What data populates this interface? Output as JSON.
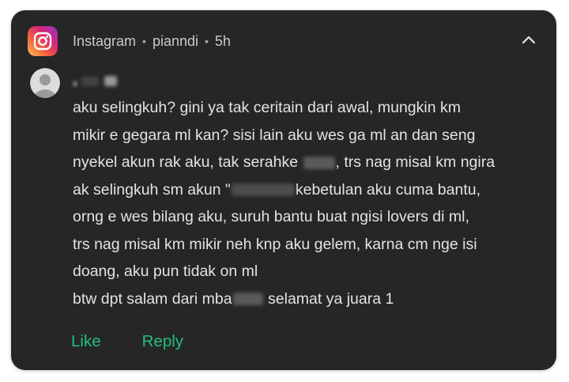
{
  "notification": {
    "app": "Instagram",
    "account": "pianndi",
    "time": "5h",
    "separator": "•",
    "message_lines": [
      "aku selingkuh? gini ya tak ceritain dari awal, mungkin km",
      "mikir e gegara ml kan? sisi lain aku wes ga ml an dan seng",
      [
        "nyekel akun rak aku, tak serahke ",
        ", trs nag misal km ngira"
      ],
      [
        "ak selingkuh sm akun \"",
        "kebetulan aku cuma bantu,"
      ],
      "orng e wes bilang aku, suruh bantu buat ngisi lovers di ml,",
      "trs nag misal km mikir neh knp aku gelem, karna cm nge isi",
      "doang, aku pun tidak on ml",
      [
        "btw dpt salam dari mba",
        " selamat ya juara 1"
      ]
    ],
    "actions": {
      "like": "Like",
      "reply": "Reply"
    }
  },
  "colors": {
    "background": "#262626",
    "text": "#e3e3e3",
    "header_text": "#c9c9c9",
    "action": "#21c07a"
  },
  "icons": {
    "app": "instagram-icon",
    "avatar": "default-avatar-icon",
    "collapse": "chevron-up-icon"
  }
}
